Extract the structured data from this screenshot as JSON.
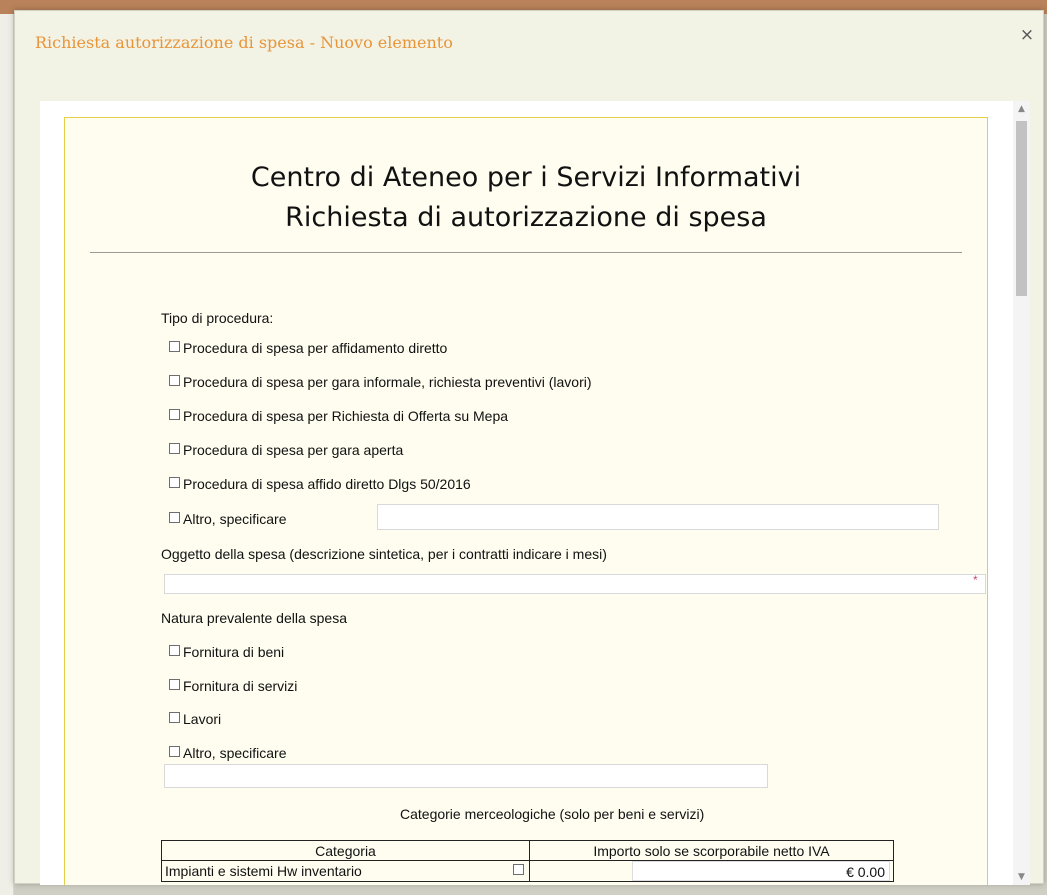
{
  "dialog": {
    "title": "Richiesta autorizzazione di spesa - Nuovo elemento",
    "close_glyph": "×"
  },
  "form": {
    "heading_line1": "Centro di Ateneo per i Servizi Informativi",
    "heading_line2": "Richiesta di autorizzazione di spesa",
    "procedure": {
      "label": "Tipo di procedura:",
      "options": [
        "Procedura di spesa per affidamento diretto",
        "Procedura di spesa per gara informale, richiesta preventivi (lavori)",
        "Procedura di spesa per Richiesta di Offerta su Mepa",
        "Procedura di spesa per gara aperta",
        "Procedura di spesa affido diretto  Dlgs 50/2016",
        "Altro, specificare"
      ],
      "other_value": ""
    },
    "subject": {
      "label": "Oggetto della spesa (descrizione sintetica, per i contratti indicare i mesi)",
      "value": "",
      "required_mark": "*"
    },
    "nature": {
      "label": "Natura prevalente della spesa",
      "options": [
        "Fornitura di beni",
        "Fornitura di servizi",
        "Lavori",
        "Altro, specificare"
      ],
      "other_value": ""
    },
    "categories": {
      "title": "Categorie merceologiche (solo per beni e servizi)",
      "col_category": "Categoria",
      "col_amount": "Importo solo se scorporabile netto IVA",
      "rows": [
        {
          "name": "Impianti e sistemi Hw inventario",
          "amount": "€ 0.00"
        }
      ]
    }
  },
  "icons": {
    "close": "close-icon",
    "checkbox": "checkbox-icon",
    "scroll_up": "chevron-up-icon",
    "scroll_down": "chevron-down-icon"
  },
  "colors": {
    "title_orange": "#e8953a",
    "form_bg": "#fffdf0",
    "form_border": "#e3cf4a",
    "required": "#d14a6a"
  }
}
